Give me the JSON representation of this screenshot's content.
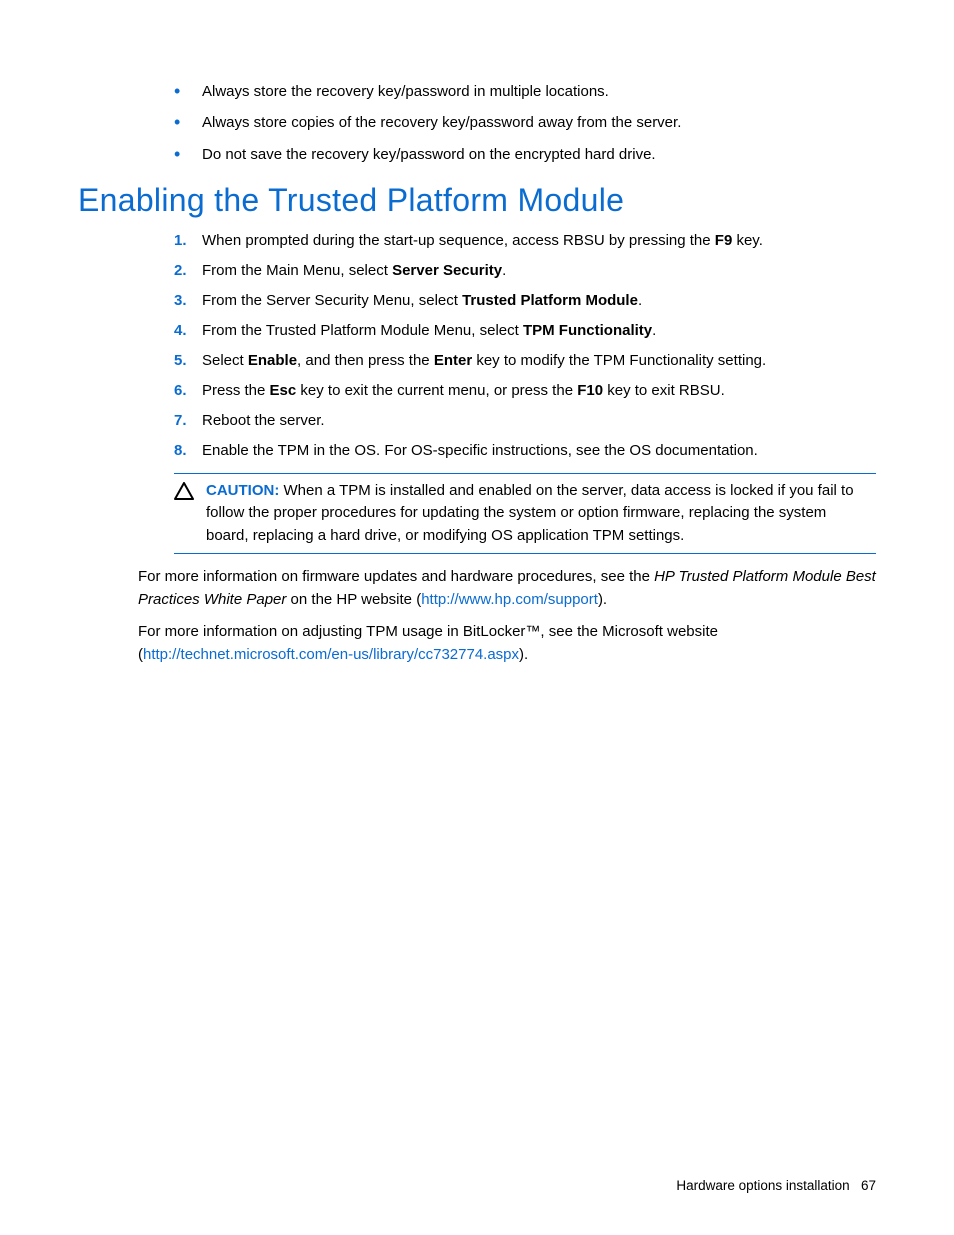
{
  "bullets": [
    "Always store the recovery key/password in multiple locations.",
    "Always store copies of the recovery key/password away from the server.",
    "Do not save the recovery key/password on the encrypted hard drive."
  ],
  "heading": "Enabling the Trusted Platform Module",
  "steps": {
    "s1_a": "When prompted during the start-up sequence, access RBSU by pressing the ",
    "s1_b": "F9",
    "s1_c": " key.",
    "s2_a": "From the Main Menu, select ",
    "s2_b": "Server Security",
    "s2_c": ".",
    "s3_a": "From the Server Security Menu, select ",
    "s3_b": "Trusted Platform Module",
    "s3_c": ".",
    "s4_a": "From the Trusted Platform Module Menu, select ",
    "s4_b": "TPM Functionality",
    "s4_c": ".",
    "s5_a": "Select ",
    "s5_b": "Enable",
    "s5_c": ", and then press the ",
    "s5_d": "Enter",
    "s5_e": " key to modify the TPM Functionality setting.",
    "s6_a": "Press the ",
    "s6_b": "Esc",
    "s6_c": " key to exit the current menu, or press the ",
    "s6_d": "F10",
    "s6_e": " key to exit RBSU.",
    "s7": "Reboot the server.",
    "s8": "Enable the TPM in the OS. For OS-specific instructions, see the OS documentation."
  },
  "caution": {
    "label": "CAUTION:",
    "text": "  When a TPM is installed and enabled on the server, data access is locked if you fail to follow the proper procedures for updating the system or option firmware, replacing the system board, replacing a hard drive, or modifying OS application TPM settings."
  },
  "para1": {
    "a": "For more information on firmware updates and hardware procedures, see the ",
    "b": "HP Trusted Platform Module Best Practices White Paper",
    "c": " on the HP website (",
    "link": "http://www.hp.com/support",
    "d": ")."
  },
  "para2": {
    "a": "For more information on adjusting TPM usage in BitLocker™, see the Microsoft website (",
    "link": "http://technet.microsoft.com/en-us/library/cc732774.aspx",
    "b": ")."
  },
  "footer": {
    "section": "Hardware options installation",
    "page": "67"
  }
}
